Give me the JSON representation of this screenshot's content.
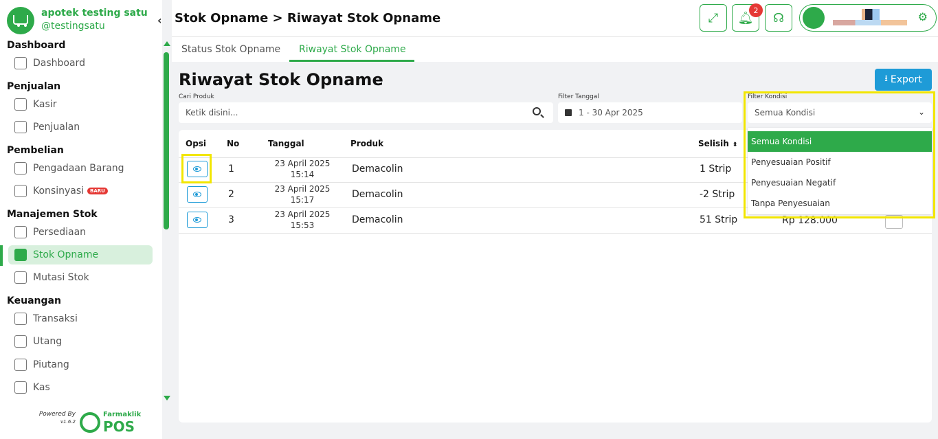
{
  "sidebar": {
    "brand_name": "apotek testing satu",
    "brand_user": "@testingsatu",
    "collapse_icon": "‹",
    "sections": [
      {
        "title": "Dashboard",
        "items": [
          {
            "label": "Dashboard",
            "icon": "grid-icon"
          }
        ]
      },
      {
        "title": "Penjualan",
        "items": [
          {
            "label": "Kasir",
            "icon": "cash-register-icon"
          },
          {
            "label": "Penjualan",
            "icon": "shopping-bag-icon"
          }
        ]
      },
      {
        "title": "Pembelian",
        "items": [
          {
            "label": "Pengadaan Barang",
            "icon": "procurement-icon"
          },
          {
            "label": "Konsinyasi",
            "icon": "box-icon",
            "badge": "BARU"
          }
        ]
      },
      {
        "title": "Manajemen Stok",
        "items": [
          {
            "label": "Persediaan",
            "icon": "inventory-icon"
          },
          {
            "label": "Stok Opname",
            "icon": "stock-opname-icon",
            "active": true
          },
          {
            "label": "Mutasi Stok",
            "icon": "mutation-icon"
          }
        ]
      },
      {
        "title": "Keuangan",
        "items": [
          {
            "label": "Transaksi",
            "icon": "transfer-icon"
          },
          {
            "label": "Utang",
            "icon": "document-icon"
          },
          {
            "label": "Piutang",
            "icon": "document-icon"
          },
          {
            "label": "Kas",
            "icon": "exchange-icon"
          }
        ]
      }
    ],
    "powered_by": "Powered By",
    "version": "v1.6.2",
    "footer_logo_top": "Farmaklik",
    "footer_logo_bottom": "POS"
  },
  "topbar": {
    "title": "Stok Opname > Riwayat Stok Opname",
    "notification_count": "2"
  },
  "tabs": [
    {
      "label": "Status Stok Opname",
      "active": false
    },
    {
      "label": "Riwayat Stok Opname",
      "active": true
    }
  ],
  "main": {
    "heading": "Riwayat Stok Opname",
    "export_label": "Export",
    "search": {
      "label": "Cari Produk",
      "placeholder": "Ketik disini..."
    },
    "date_filter": {
      "label": "Filter Tanggal",
      "value": "1 - 30 Apr 2025"
    },
    "condition_filter": {
      "label": "Filter Kondisi",
      "value": "Semua Kondisi"
    }
  },
  "table": {
    "columns": [
      "Opsi",
      "No",
      "Tanggal",
      "Produk",
      "Selisih"
    ],
    "rows": [
      {
        "no": "1",
        "date": "23 April 2025",
        "time": "15:14",
        "product": "Demacolin",
        "diff": "1 Strip"
      },
      {
        "no": "2",
        "date": "23 April 2025",
        "time": "15:17",
        "product": "Demacolin",
        "diff": "-2 Strip"
      },
      {
        "no": "3",
        "date": "23 April 2025",
        "time": "15:53",
        "product": "Demacolin",
        "diff": "51 Strip"
      }
    ],
    "partial_value": "Rp 128.000"
  },
  "dropdown": {
    "options": [
      "Semua Kondisi",
      "Penyesuaian Positif",
      "Penyesuaian Negatif",
      "Tanpa Penyesuaian"
    ],
    "selected": "Semua Kondisi"
  },
  "colors": {
    "brand": "#2eaa4a",
    "accent": "#1e9bd7",
    "highlight": "#f2e600",
    "badge": "#e53935"
  }
}
